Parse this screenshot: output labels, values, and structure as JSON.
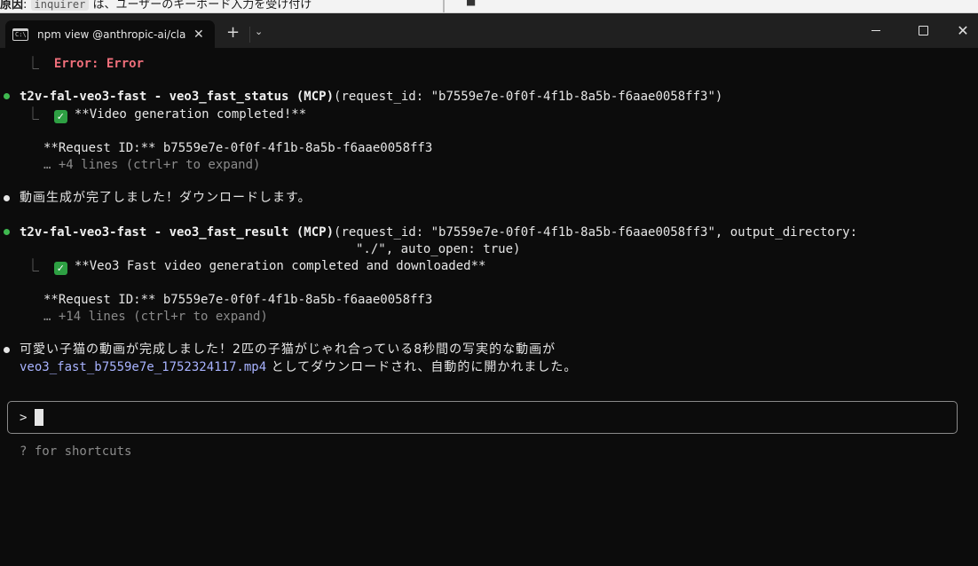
{
  "background_window": {
    "label": "原因",
    "code": "inquirer",
    "text": "は、ユーザーのキーボード入力を受け付け",
    "right_glyph": "■"
  },
  "titlebar": {
    "tab_title": "npm view @anthropic-ai/claude",
    "tab_icon_text": "C:\\",
    "close_label": "✕",
    "new_tab": "+",
    "dropdown": "⌄",
    "minimize_icon": "minimize-icon",
    "maximize_icon": "maximize-icon",
    "close_window": "✕"
  },
  "terminal": {
    "error_line": "Error: Error",
    "corner_glyph": "⎿",
    "call1": {
      "name": "t2v-fal-veo3-fast - veo3_fast_status (MCP)",
      "args": "(request_id: \"b7559e7e-0f0f-4f1b-8a5b-f6aae0058ff3\")",
      "result": "**Video generation completed!**",
      "request_id": "**Request ID:** b7559e7e-0f0f-4f1b-8a5b-f6aae0058ff3",
      "more": "… +4 lines (ctrl+r to expand)"
    },
    "msg1": "動画生成が完了しました！ダウンロードします。",
    "call2": {
      "name": "t2v-fal-veo3-fast - veo3_fast_result (MCP)",
      "args": "(request_id: \"b7559e7e-0f0f-4f1b-8a5b-f6aae0058ff3\", output_directory:",
      "args2": "\"./\", auto_open: true)",
      "result": "**Veo3 Fast video generation completed and downloaded**",
      "request_id": "**Request ID:** b7559e7e-0f0f-4f1b-8a5b-f6aae0058ff3",
      "more": "… +14 lines (ctrl+r to expand)"
    },
    "msg2_line1": "可愛い子猫の動画が完成しました！2匹の子猫がじゃれ合っている8秒間の写実的な動画が",
    "msg2_file": "veo3_fast_b7559e7e_1752324117.mp4",
    "msg2_rest": " としてダウンロードされ、自動的に開かれました。",
    "prompt": ">",
    "hint": "? for shortcuts"
  },
  "colors": {
    "background": "#0c0c0c",
    "bullet_green": "#3fb950",
    "error": "#ef6f7b",
    "link": "#a8b3ff",
    "dim": "#8b8b8b"
  }
}
